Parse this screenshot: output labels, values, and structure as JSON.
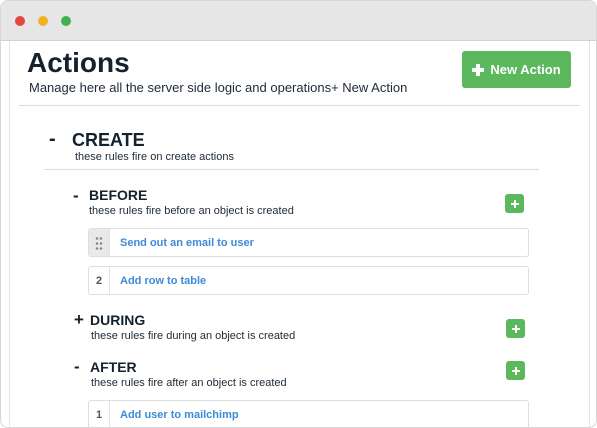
{
  "window": {
    "colors": {
      "close": "#e2463f",
      "minimize": "#efb422",
      "maximize": "#3fb34f"
    }
  },
  "header": {
    "title": "Actions",
    "subtitle": "Manage here all the server side logic and operations+ New Action",
    "new_action_label": "New Action",
    "accent_color": "#5cb85c"
  },
  "create": {
    "toggle": "-",
    "title": "CREATE",
    "description": "these rules fire on create actions",
    "before": {
      "toggle": "-",
      "title": "BEFORE",
      "description": "these rules fire before an object is created",
      "rules": [
        {
          "handle": "",
          "label": "Send out an email to user"
        },
        {
          "handle": "2",
          "label": "Add row to table"
        }
      ]
    },
    "during": {
      "toggle": "+",
      "title": "DURING",
      "description": "these rules fire during an object is created"
    },
    "after": {
      "toggle": "-",
      "title": "AFTER",
      "description": "these rules fire after an object is created",
      "rules": [
        {
          "handle": "1",
          "label": "Add user to mailchimp"
        }
      ]
    }
  }
}
